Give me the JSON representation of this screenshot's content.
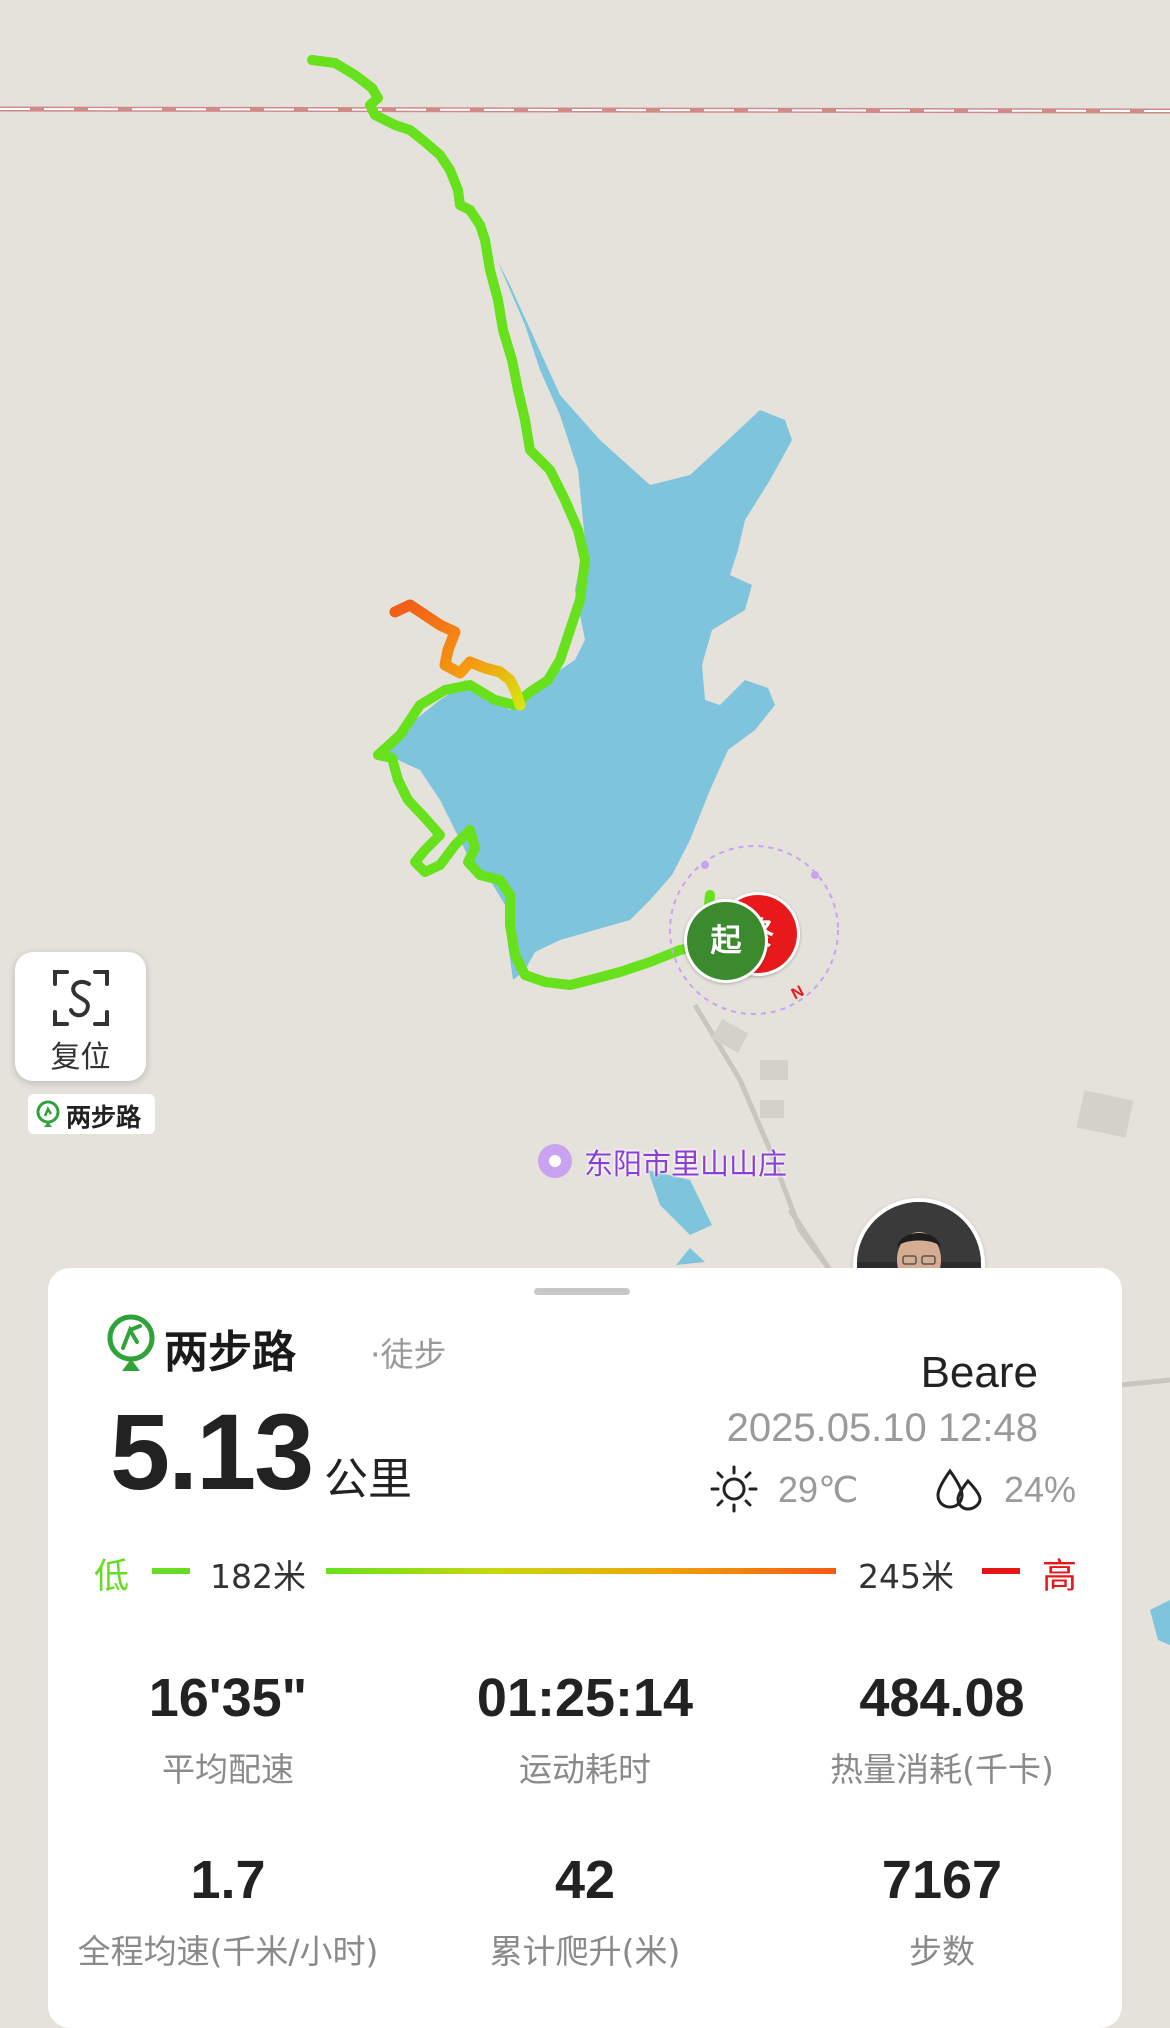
{
  "map": {
    "reset_label": "复位",
    "watermark": "两步路",
    "poi_label": "东阳市里山山庄",
    "start_pin": "起",
    "end_pin": "终",
    "compass_mark": "N"
  },
  "summary": {
    "brand": "两步路",
    "activity_type": "·徒步",
    "distance_value": "5.13",
    "distance_unit": "公里",
    "username": "Beare",
    "datetime": "2025.05.10 12:48",
    "temperature": "29℃",
    "humidity": "24%"
  },
  "elevation": {
    "low_label": "低",
    "low_value": "182米",
    "high_value": "245米",
    "high_label": "高"
  },
  "stats": [
    {
      "value": "16'35\"",
      "label": "平均配速"
    },
    {
      "value": "01:25:14",
      "label": "运动耗时"
    },
    {
      "value": "484.08",
      "label": "热量消耗(千卡)"
    },
    {
      "value": "1.7",
      "label": "全程均速(千米/小时)"
    },
    {
      "value": "42",
      "label": "累计爬升(米)"
    },
    {
      "value": "7167",
      "label": "步数"
    }
  ],
  "colors": {
    "track_low": "#66e11c",
    "track_high": "#f45a16",
    "lake": "#7fc4dd",
    "start": "#3b8b2e",
    "end": "#e8191a"
  }
}
